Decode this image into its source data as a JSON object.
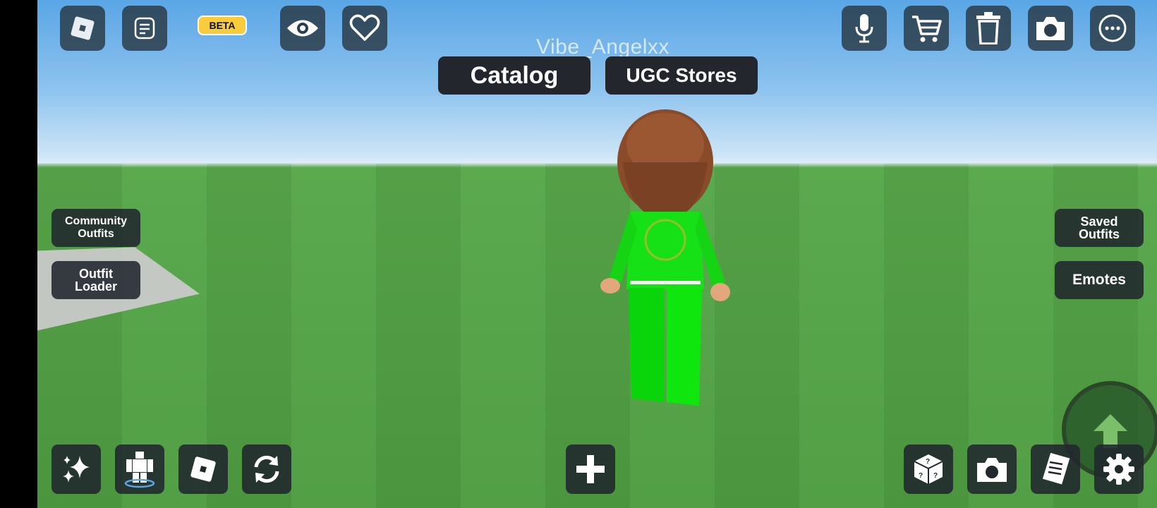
{
  "player": {
    "username": "Vibe_Angelxx"
  },
  "top_bar": {
    "beta_label": "BETA",
    "icons": [
      "roblox-logo-icon",
      "chat-icon",
      "eye-icon",
      "heart-icon",
      "microphone-icon",
      "cart-icon",
      "trash-icon",
      "camera-icon",
      "more-icon"
    ]
  },
  "tabs": {
    "catalog": "Catalog",
    "ugc_stores": "UGC Stores"
  },
  "side_left": {
    "community_outfits": "Community\nOutfits",
    "outfit_loader": "Outfit\nLoader"
  },
  "side_right": {
    "saved_outfits": "Saved\nOutfits",
    "emotes": "Emotes"
  },
  "bottom_bar": {
    "icons": [
      "sparkles-icon",
      "avatar-body-icon",
      "roblox-square-icon",
      "refresh-icon",
      "plus-icon",
      "mystery-dice-icon",
      "camera-icon",
      "receipt-icon",
      "settings-gear-icon"
    ]
  },
  "colors": {
    "button_bg": "#21272d",
    "beta_badge": "#f8cc3a",
    "ground": "#4f9d42",
    "sky": "#5aa6e6",
    "avatar_suit": "#14e014",
    "hair": "#8a4b2a"
  }
}
